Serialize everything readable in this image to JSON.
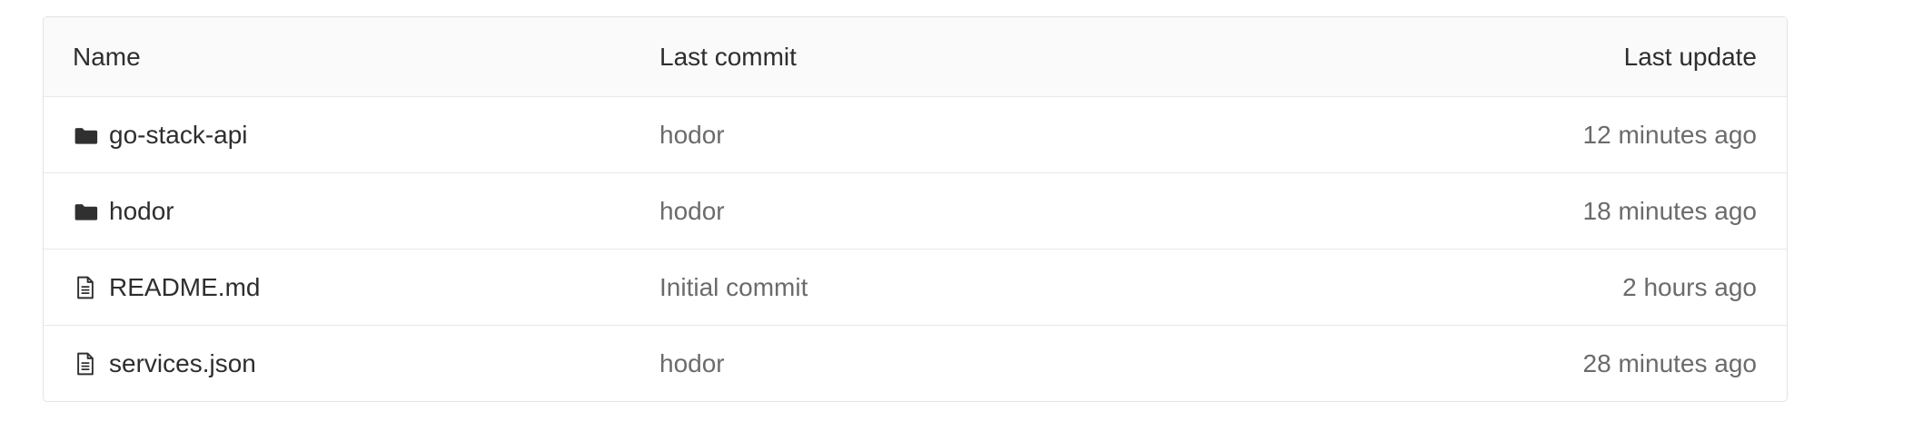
{
  "table": {
    "headers": {
      "name": "Name",
      "last_commit": "Last commit",
      "last_update": "Last update"
    },
    "rows": [
      {
        "icon": "folder-icon",
        "name": "go-stack-api",
        "last_commit": "hodor",
        "last_update": "12 minutes ago"
      },
      {
        "icon": "folder-icon",
        "name": "hodor",
        "last_commit": "hodor",
        "last_update": "18 minutes ago"
      },
      {
        "icon": "file-icon",
        "name": "README.md",
        "last_commit": "Initial commit",
        "last_update": "2 hours ago"
      },
      {
        "icon": "file-icon",
        "name": "services.json",
        "last_commit": "hodor",
        "last_update": "28 minutes ago"
      }
    ]
  }
}
